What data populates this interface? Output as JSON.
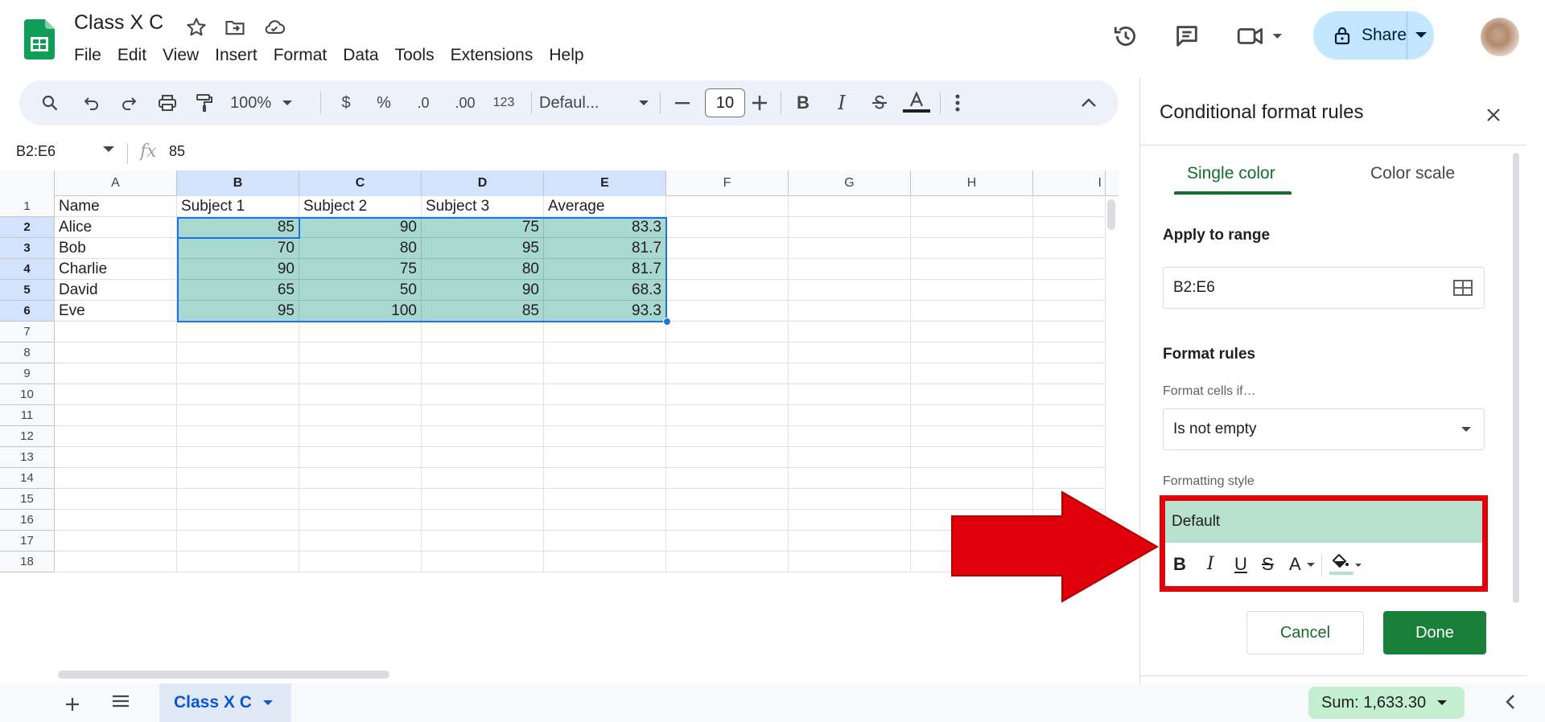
{
  "doc": {
    "title": "Class X C"
  },
  "menu": [
    "File",
    "Edit",
    "View",
    "Insert",
    "Format",
    "Data",
    "Tools",
    "Extensions",
    "Help"
  ],
  "share": {
    "label": "Share"
  },
  "toolbar": {
    "zoom": "100%",
    "currency": "$",
    "percent": "%",
    "dec_decrease": ".0",
    "dec_increase": ".00",
    "number_format": "123",
    "font": "Defaul...",
    "font_size": "10"
  },
  "formula_bar": {
    "name_box": "B2:E6",
    "fx": "fx",
    "value": "85"
  },
  "grid": {
    "columns": [
      "A",
      "B",
      "C",
      "D",
      "E",
      "F",
      "G",
      "H",
      "I"
    ],
    "rows": [
      "1",
      "2",
      "3",
      "4",
      "5",
      "6",
      "7",
      "8",
      "9",
      "10",
      "11",
      "12",
      "13",
      "14",
      "15",
      "16",
      "17",
      "18"
    ],
    "cells": [
      [
        "Name",
        "Subject 1",
        "Subject 2",
        "Subject 3",
        "Average"
      ],
      [
        "Alice",
        "85",
        "90",
        "75",
        "83.3"
      ],
      [
        "Bob",
        "70",
        "80",
        "95",
        "81.7"
      ],
      [
        "Charlie",
        "90",
        "75",
        "80",
        "81.7"
      ],
      [
        "David",
        "65",
        "50",
        "90",
        "68.3"
      ],
      [
        "Eve",
        "95",
        "100",
        "85",
        "93.3"
      ]
    ]
  },
  "bottom": {
    "sheet_name": "Class X C",
    "sum": "Sum: 1,633.30"
  },
  "panel": {
    "title": "Conditional format rules",
    "tab_single": "Single color",
    "tab_scale": "Color scale",
    "apply_range_label": "Apply to range",
    "range_value": "B2:E6",
    "format_rules_label": "Format rules",
    "condition_label": "Format cells if…",
    "condition_value": "Is not empty",
    "style_label": "Formatting style",
    "style_preview": "Default",
    "style_tools": {
      "bold": "B",
      "italic": "I",
      "underline": "U",
      "strike": "S",
      "text_color": "A"
    },
    "cancel": "Cancel",
    "done": "Done"
  },
  "colors": {
    "highlight": "#a8d8cf",
    "accent_green": "#188038",
    "annotation_red": "#e0000b"
  }
}
